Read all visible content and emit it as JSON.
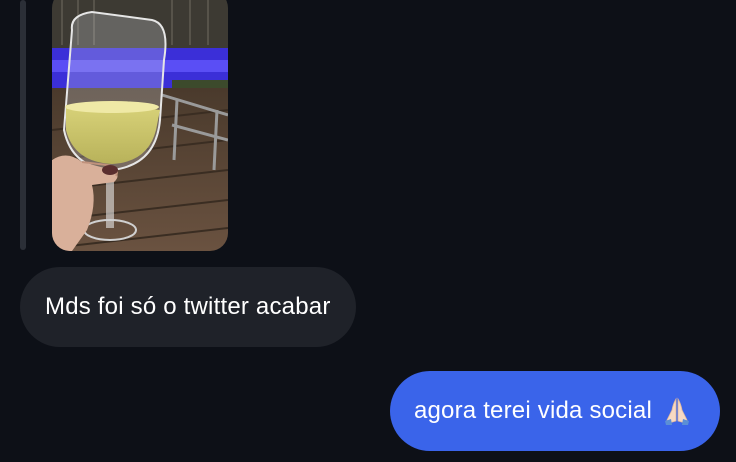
{
  "messages": [
    {
      "id": "photo-message",
      "direction": "incoming",
      "type": "image"
    },
    {
      "id": "incoming-text",
      "direction": "incoming",
      "type": "text",
      "text": "Mds foi só o twitter acabar"
    },
    {
      "id": "outgoing-text",
      "direction": "outgoing",
      "type": "text",
      "text": "agora terei vida social",
      "emoji": "praying-hands-icon"
    }
  ],
  "colors": {
    "background": "#0d1017",
    "incoming_bubble": "#1f2229",
    "outgoing_bubble": "#3a64ea",
    "reply_bar": "#2b2f37",
    "text": "#ffffff"
  }
}
